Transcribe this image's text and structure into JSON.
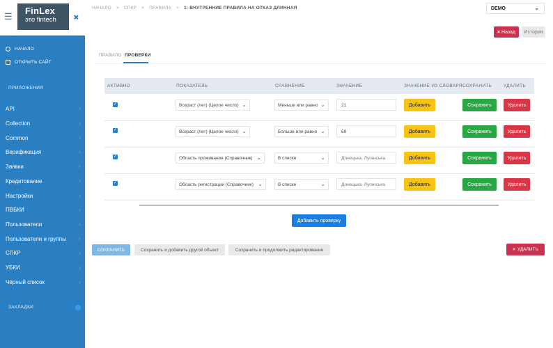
{
  "sidebar": {
    "logo_main": "FinLex",
    "logo_sub": "это fintech",
    "top_links": [
      {
        "label": "НАЧАЛО",
        "icon": "circle-icon"
      },
      {
        "label": "ОТКРЫТЬ САЙТ",
        "icon": "building-icon"
      }
    ],
    "section_apps": "ПРИЛОЖЕНИЯ",
    "items": [
      {
        "label": "API"
      },
      {
        "label": "Collection"
      },
      {
        "label": "Common"
      },
      {
        "label": "Верификация"
      },
      {
        "label": "Заявки"
      },
      {
        "label": "Кредитование"
      },
      {
        "label": "Настройки"
      },
      {
        "label": "ПВБКИ"
      },
      {
        "label": "Пользователи"
      },
      {
        "label": "Пользователи и группы"
      },
      {
        "label": "СПКР"
      },
      {
        "label": "УБКИ"
      },
      {
        "label": "Чёрный список"
      }
    ],
    "section_bookmarks": "ЗАКЛАДКИ"
  },
  "header": {
    "breadcrumb": [
      "НАЧАЛО",
      "СПКР",
      "ПРАВИЛА",
      "1: ВНУТРЕННИЕ ПРАВИЛА НА ОТКАЗ ДЛИННАЯ"
    ],
    "separator": ">",
    "env_select": "DEMO",
    "back_label": "Назад",
    "history_label": "История"
  },
  "tabs": [
    {
      "label": "ПРАВИЛО"
    },
    {
      "label": "ПРОВЕРКИ"
    }
  ],
  "table": {
    "columns": [
      "АКТИВНО",
      "ПОКАЗАТЕЛЬ",
      "СРАВНЕНИЕ",
      "ЗНАЧЕНИЕ",
      "ЗНАЧЕНИЕ ИЗ СЛОВАРЯ",
      "СОХРАНИТЬ",
      "УДАЛИТЬ"
    ],
    "rows": [
      {
        "active": true,
        "indicator": "Возраст (лет) (Целое число)",
        "comparison": "Меньше или равно",
        "value": "21"
      },
      {
        "active": true,
        "indicator": "Возраст (лет) (Целое число)",
        "comparison": "Больше или равно",
        "value": "69"
      },
      {
        "active": true,
        "indicator": "Область проживания (Справочник)",
        "comparison": "В списке",
        "value": "Донецька, Луганська"
      },
      {
        "active": true,
        "indicator": "Область регистрации (Справочник)",
        "comparison": "В списке",
        "value": "Донецька, Луганська"
      }
    ],
    "dict_button": "Добавить",
    "save_button": "Сохранить",
    "delete_button": "Удалить",
    "add_check_button": "Добавить проверку"
  },
  "footer": {
    "submit": "СОХРАНИТЬ",
    "save_add": "Сохранить и добавить другой объект",
    "save_continue": "Сохранить и продолжить редактирование",
    "delete": "УДАЛИТЬ"
  }
}
